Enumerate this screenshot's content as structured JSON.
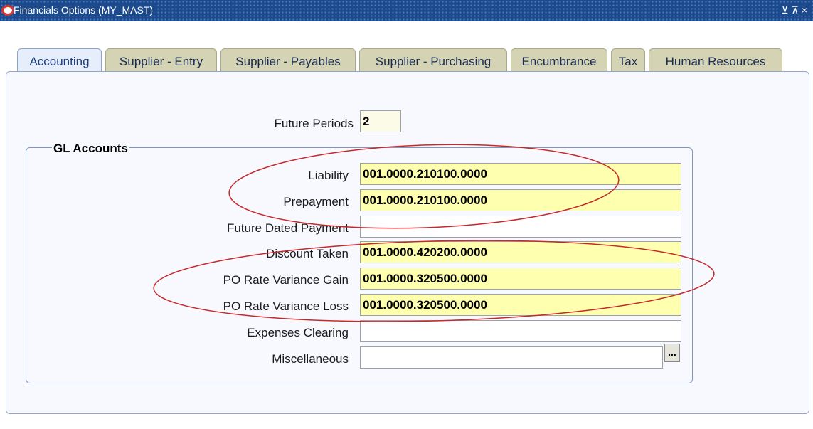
{
  "window": {
    "title": "Financials Options (MY_MAST)",
    "controls": [
      "⊻",
      "⊼",
      "×"
    ]
  },
  "tabs": [
    {
      "label": "Accounting",
      "active": true
    },
    {
      "label": "Supplier - Entry",
      "active": false
    },
    {
      "label": "Supplier - Payables",
      "active": false
    },
    {
      "label": "Supplier - Purchasing",
      "active": false
    },
    {
      "label": "Encumbrance",
      "active": false
    },
    {
      "label": "Tax",
      "active": false
    },
    {
      "label": "Human Resources",
      "active": false
    }
  ],
  "form": {
    "future_periods": {
      "label": "Future Periods",
      "value": "2"
    },
    "gl_accounts": {
      "title": "GL Accounts",
      "fields": [
        {
          "label": "Liability",
          "value": "001.0000.210100.0000"
        },
        {
          "label": "Prepayment",
          "value": "001.0000.210100.0000"
        },
        {
          "label": "Future Dated Payment",
          "value": ""
        },
        {
          "label": "Discount Taken",
          "value": "001.0000.420200.0000"
        },
        {
          "label": "PO Rate Variance Gain",
          "value": "001.0000.320500.0000"
        },
        {
          "label": "PO Rate Variance Loss",
          "value": "001.0000.320500.0000"
        },
        {
          "label": "Expenses Clearing",
          "value": ""
        },
        {
          "label": "Miscellaneous",
          "value": ""
        }
      ],
      "lov_button": "..."
    }
  },
  "colors": {
    "titlebar": "#1c4a8c",
    "active_tab": "#e6eefb",
    "inactive_tab": "#d4d4b4",
    "required_field": "#ffffb0",
    "annotation": "#c8282a"
  }
}
